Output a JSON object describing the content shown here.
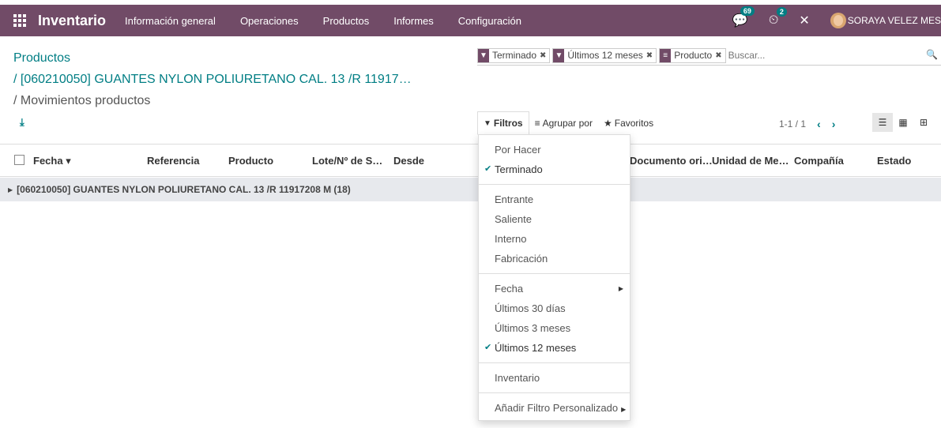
{
  "navbar": {
    "brand": "Inventario",
    "menu": [
      "Información general",
      "Operaciones",
      "Productos",
      "Informes",
      "Configuración"
    ],
    "chat_badge": "69",
    "activity_badge": "2",
    "user_name": "SORAYA VELEZ MES"
  },
  "breadcrumb": {
    "item1": "Productos",
    "item2": "/ [060210050] GUANTES NYLON POLIURETANO CAL. 13 /R 11917…",
    "item3": "/ Movimientos productos"
  },
  "search": {
    "facets": [
      {
        "icon": "filter-icon",
        "label": "Terminado"
      },
      {
        "icon": "filter-icon",
        "label": "Últimos 12 meses"
      },
      {
        "icon": "groupby-icon",
        "label": "Producto"
      }
    ],
    "placeholder": "Buscar..."
  },
  "toolbar": {
    "filters_label": "Filtros",
    "groupby_label": "Agrupar por",
    "favorites_label": "Favoritos"
  },
  "pager": {
    "range": "1-1 / 1"
  },
  "table": {
    "columns": [
      "Fecha",
      "Referencia",
      "Producto",
      "Lote/Nº de S…",
      "Desde",
      "Documento ori…",
      "Unidad de Me…",
      "Compañía",
      "Estado"
    ],
    "group_row": "[060210050] GUANTES NYLON POLIURETANO CAL. 13 /R 11917208 M (18)"
  },
  "filter_menu": {
    "items": [
      {
        "label": "Por Hacer",
        "checked": false
      },
      {
        "label": "Terminado",
        "checked": true
      },
      {
        "label": "Entrante",
        "checked": false
      },
      {
        "label": "Saliente",
        "checked": false
      },
      {
        "label": "Interno",
        "checked": false
      },
      {
        "label": "Fabricación",
        "checked": false
      },
      {
        "label": "Fecha",
        "checked": false
      },
      {
        "label": "Últimos 30 días",
        "checked": false
      },
      {
        "label": "Últimos 3 meses",
        "checked": false
      },
      {
        "label": "Últimos 12 meses",
        "checked": true
      },
      {
        "label": "Inventario",
        "checked": false
      },
      {
        "label": "Añadir Filtro Personalizado",
        "checked": false
      }
    ]
  },
  "colors": {
    "brand": "#714b67",
    "accent": "#017e84",
    "group_bg": "#e7e9ed"
  }
}
